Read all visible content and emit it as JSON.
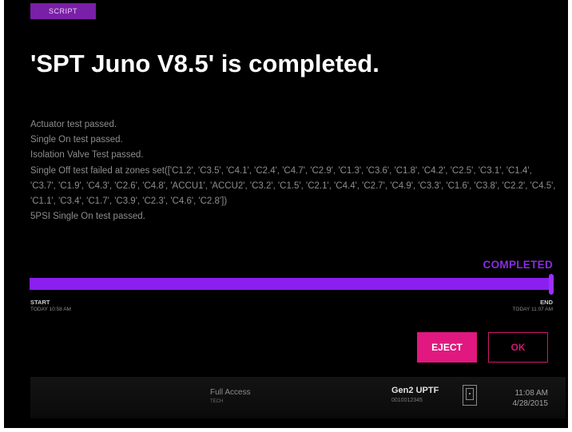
{
  "header": {
    "tag": "SCRIPT",
    "title": "'SPT Juno V8.5' is completed."
  },
  "log": [
    "Actuator test passed.",
    "Single On test passed.",
    "Isolation Valve Test passed.",
    "Single Off test failed at zones set(['C1.2', 'C3.5', 'C4.1', 'C2.4', 'C4.7', 'C2.9', 'C1.3', 'C3.6', 'C1.8', 'C4.2', 'C2.5', 'C3.1', 'C1.4', 'C3.7', 'C1.9', 'C4.3', 'C2.6', 'C4.8', 'ACCU1', 'ACCU2', 'C3.2', 'C1.5', 'C2.1', 'C4.4', 'C2.7', 'C4.9', 'C3.3', 'C1.6', 'C3.8', 'C2.2', 'C4.5', 'C1.1', 'C3.4', 'C1.7', 'C3.9', 'C2.3', 'C4.6', 'C2.8'])",
    "5PSI Single On test passed."
  ],
  "progress": {
    "status": "COMPLETED",
    "percent": 100,
    "start_label": "START",
    "start_time": "TODAY 10:58 AM",
    "end_label": "END",
    "end_time": "TODAY 11:07 AM"
  },
  "buttons": {
    "eject": "EJECT",
    "ok": "OK"
  },
  "footer": {
    "access": "Full Access",
    "access_role": "TECH",
    "device_name": "Gen2 UPTF",
    "device_id": "0010012345",
    "time": "11:08 AM",
    "date": "4/28/2015"
  },
  "colors": {
    "accent_purple": "#8a1ff0",
    "accent_pink": "#e0187f",
    "background": "#000000"
  },
  "icons": {
    "device": "device-icon"
  }
}
